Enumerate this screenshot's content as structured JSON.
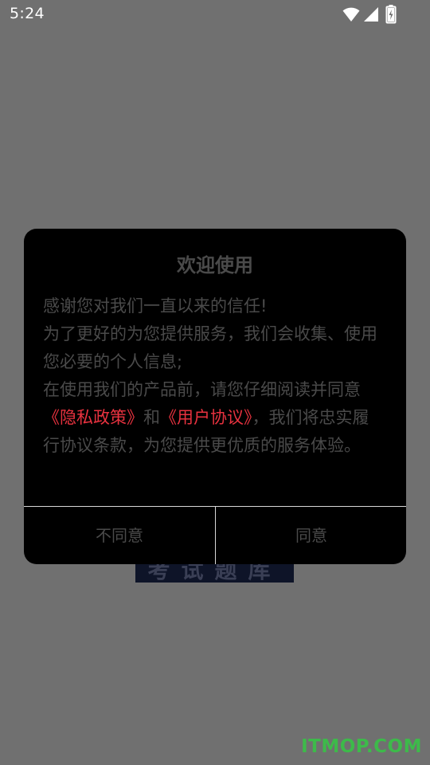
{
  "status_bar": {
    "time": "5:24",
    "icons": [
      "wifi-icon",
      "signal-icon",
      "battery-charging-icon"
    ]
  },
  "background": {
    "logo_text": "考试题库"
  },
  "dialog": {
    "title": "欢迎使用",
    "paragraphs": {
      "p1": "感谢您对我们一直以来的信任!",
      "p2": "为了更好的为您提供服务，我们会收集、使用您必要的个人信息;",
      "p3_prefix": "在使用我们的产品前，请您仔细阅读并同意",
      "privacy_link": "《隐私政策》",
      "p3_and": "和",
      "terms_link": "《用户协议》",
      "p3_suffix": "，我们将忠实履行协议条款，为您提供更优质的服务体验。"
    },
    "buttons": {
      "disagree": "不同意",
      "agree": "同意"
    }
  },
  "watermark": "ITMOP.COM",
  "colors": {
    "overlay": "#707070",
    "dialog_bg": "#000000",
    "link": "#e8323f",
    "watermark": "#3dba4a"
  }
}
